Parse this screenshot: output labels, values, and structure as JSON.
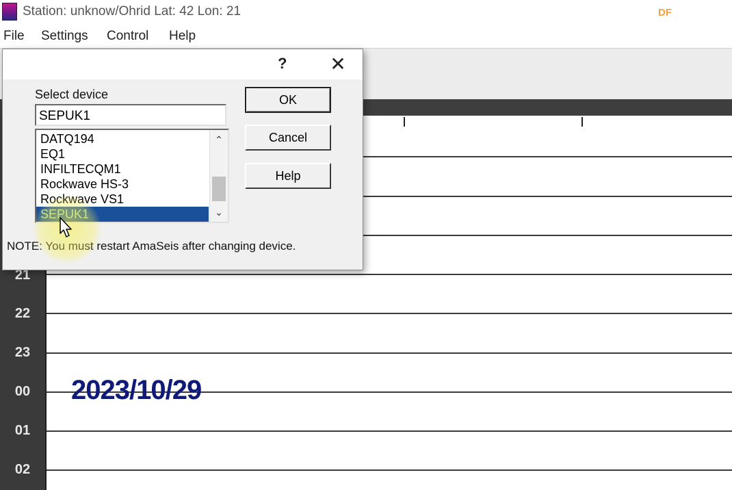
{
  "window": {
    "title": "Station: unknow/Ohrid Lat: 42 Lon: 21",
    "watermark": "DF"
  },
  "menu": [
    {
      "label": "File"
    },
    {
      "label": "Settings"
    },
    {
      "label": "Control"
    },
    {
      "label": "Help"
    }
  ],
  "dialog": {
    "help_glyph": "?",
    "close_glyph": "✕",
    "select_label": "Select device",
    "device_value": "SEPUK1",
    "devices": [
      {
        "label": "DATQ194",
        "selected": false
      },
      {
        "label": "EQ1",
        "selected": false
      },
      {
        "label": "INFILTECQM1",
        "selected": false
      },
      {
        "label": "Rockwave HS-3",
        "selected": false
      },
      {
        "label": "Rockwave VS1",
        "selected": false
      },
      {
        "label": "SEPUK1",
        "selected": true
      }
    ],
    "buttons": {
      "ok": "OK",
      "cancel": "Cancel",
      "help": "Help"
    },
    "note": "NOTE: You must restart AmaSeis after changing device.",
    "scroll_up_glyph": "⌃",
    "scroll_down_glyph": "⌄"
  },
  "helicorder": {
    "hour_labels": [
      "21",
      "22",
      "23",
      "00",
      "01",
      "02"
    ],
    "date_label": "2023/10/29"
  },
  "colors": {
    "selection": "#1a4f9a",
    "date_text": "#101a78",
    "hour_column": "#3a3a3a",
    "highlight": "#f5f050"
  }
}
